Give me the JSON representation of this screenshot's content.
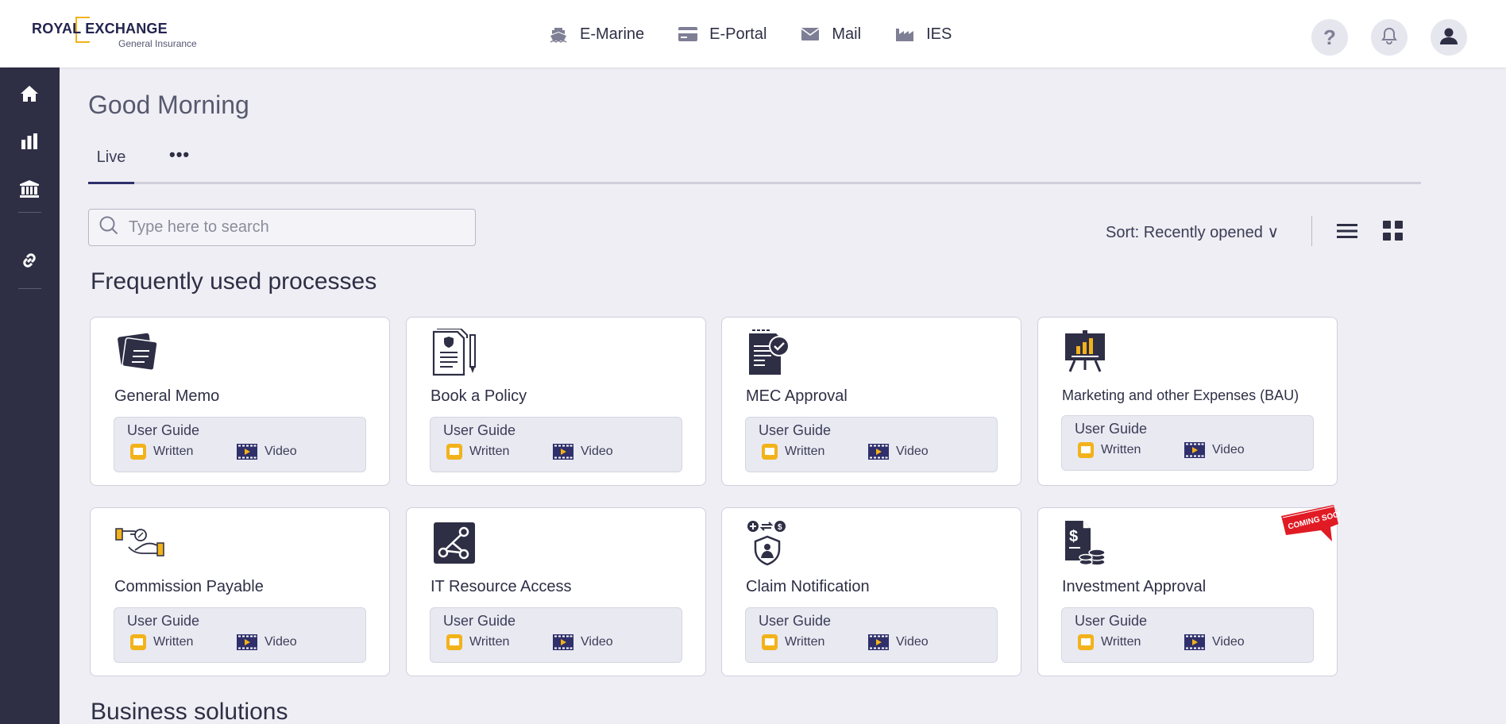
{
  "brand": {
    "name": "ROYAL EXCHANGE",
    "subtitle": "General Insurance"
  },
  "topnav": [
    {
      "label": "E-Marine",
      "icon": "ship-icon"
    },
    {
      "label": "E-Portal",
      "icon": "card-icon"
    },
    {
      "label": "Mail",
      "icon": "mail-icon"
    },
    {
      "label": "IES",
      "icon": "factory-icon"
    }
  ],
  "header_actions": [
    "help-icon",
    "bell-icon",
    "user-icon"
  ],
  "sidebar": [
    "home-icon",
    "chart-icon",
    "building-icon",
    "link-icon"
  ],
  "greeting": "Good Morning",
  "tabs": {
    "live": "Live",
    "more": "•••"
  },
  "search": {
    "placeholder": "Type here to search",
    "value": ""
  },
  "sort": {
    "label": "Sort: Recently opened ∨"
  },
  "sections": {
    "frequent": "Frequently used processes",
    "business": "Business solutions"
  },
  "guide": {
    "title": "User Guide",
    "written": "Written",
    "video": "Video"
  },
  "cards": [
    {
      "title": "General Memo",
      "icon": "memo-icon"
    },
    {
      "title": "Book a Policy",
      "icon": "policy-icon"
    },
    {
      "title": "MEC Approval",
      "icon": "approval-document-icon"
    },
    {
      "title": "Marketing and other Expenses (BAU)",
      "icon": "presentation-board-icon"
    },
    {
      "title": "Commission Payable",
      "icon": "hand-coin-icon"
    },
    {
      "title": "IT Resource Access",
      "icon": "network-icon"
    },
    {
      "title": "Claim Notification",
      "icon": "shield-person-icon"
    },
    {
      "title": "Investment Approval",
      "icon": "money-document-icon",
      "badge": "COMING SOON!"
    }
  ],
  "colors": {
    "sidebar": "#2e2f45",
    "accent": "#f2b21a",
    "navy": "#2e2f6b",
    "badge": "#e01b24"
  }
}
